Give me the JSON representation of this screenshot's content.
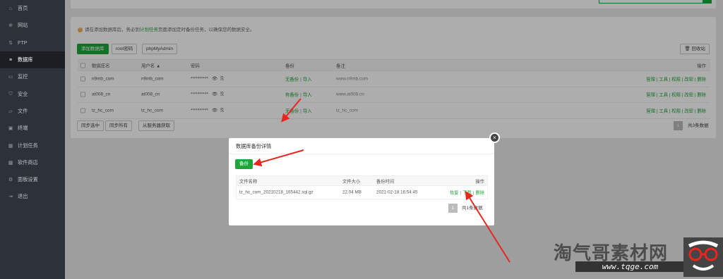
{
  "sidebar": {
    "items": [
      {
        "label": "首页",
        "icon": "home-icon",
        "glyph": "⌂"
      },
      {
        "label": "网站",
        "icon": "globe-icon",
        "glyph": "⊕"
      },
      {
        "label": "FTP",
        "icon": "ftp-icon",
        "glyph": "⇅"
      },
      {
        "label": "数据库",
        "icon": "database-icon",
        "glyph": "≡"
      },
      {
        "label": "监控",
        "icon": "monitor-icon",
        "glyph": "▭"
      },
      {
        "label": "安全",
        "icon": "shield-icon",
        "glyph": "⛉"
      },
      {
        "label": "文件",
        "icon": "folder-icon",
        "glyph": "▱"
      },
      {
        "label": "终端",
        "icon": "terminal-icon",
        "glyph": "▣"
      },
      {
        "label": "计划任务",
        "icon": "calendar-icon",
        "glyph": "▦"
      },
      {
        "label": "软件商店",
        "icon": "grid-icon",
        "glyph": "▩"
      },
      {
        "label": "面板设置",
        "icon": "settings-icon",
        "glyph": "⚙"
      },
      {
        "label": "退出",
        "icon": "logout-icon",
        "glyph": "⇥"
      }
    ],
    "active_index": 3
  },
  "warning": {
    "prefix": "请在添加数据库后，务必到",
    "link": "计划任务",
    "suffix": "页面添加定时备份任务，以确保您的数据安全。"
  },
  "toolbar": {
    "add_db": "添加数据库",
    "root_pwd": "root密码",
    "phpmyadmin": "phpMyAdmin",
    "recycle": "回收站"
  },
  "table": {
    "headers": {
      "name": "数据库名",
      "user": "用户名 ▲",
      "password": "密码",
      "backup": "备份",
      "note": "备注",
      "ops": "操作"
    },
    "rows": [
      {
        "name": "n9mb_com",
        "user": "n9mb_com",
        "password": "**********",
        "backup": "无备份",
        "import": "导入",
        "note": "www.n9mb.com"
      },
      {
        "name": "at008_cn",
        "user": "at008_cn",
        "password": "**********",
        "backup": "有备份",
        "import": "导入",
        "note": "www.at008.cn"
      },
      {
        "name": "tz_hc_com",
        "user": "tz_hc_com",
        "password": "**********",
        "backup": "无备份",
        "import": "导入",
        "note": "tz_hc_com"
      }
    ],
    "row_ops": "管理 | 工具 | 权限 | 改密 | 删除",
    "sep": "|"
  },
  "footer": {
    "sync_selected": "同步选中",
    "sync_all": "同步所有",
    "from_server": "从服务器获取",
    "page": "1",
    "total": "共3条数据"
  },
  "modal": {
    "title": "数据库备份详情",
    "backup_btn": "备份",
    "close": "×",
    "headers": {
      "file": "文件名称",
      "size": "文件大小",
      "time": "备份时间",
      "ops": "操作"
    },
    "row": {
      "file": "tz_hc_com_20210218_165442.sql.gz",
      "size": "22.04 MB",
      "time": "2021-02-18 16:54:45",
      "restore": "恢复",
      "download": "下载",
      "delete": "删除"
    },
    "page": "1",
    "total": "共1条数据"
  },
  "watermark": {
    "title": "淘气哥素材网",
    "url": "www.tqge.com"
  },
  "colors": {
    "accent": "#20a53a",
    "sidebar": "#2c3238",
    "arrow": "#e8261f"
  }
}
